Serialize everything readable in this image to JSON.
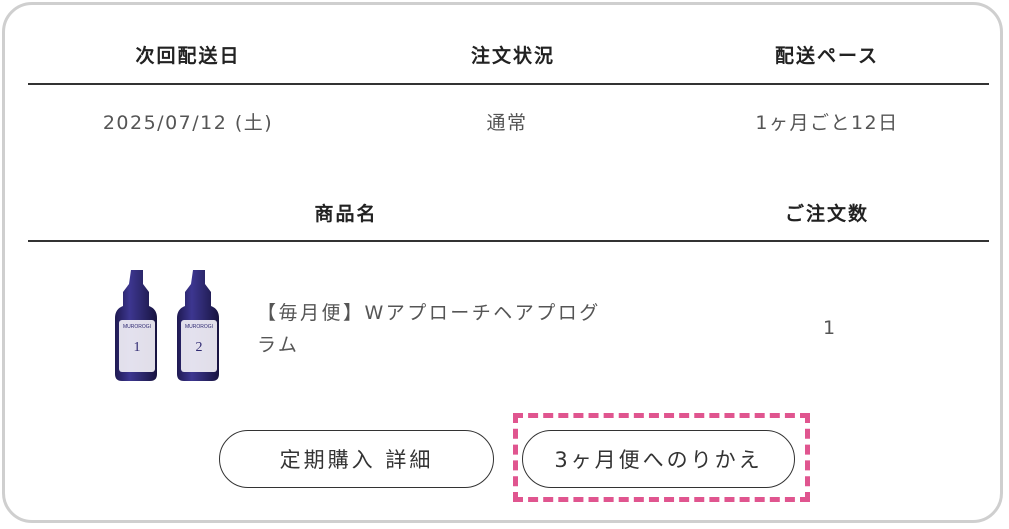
{
  "schedule": {
    "headers": [
      "次回配送日",
      "注文状況",
      "配送ペース"
    ],
    "values": [
      "2025/07/12 (土)",
      "通常",
      "1ヶ月ごと12日"
    ]
  },
  "product_table": {
    "headers": [
      "商品名",
      "ご注文数"
    ],
    "rows": [
      {
        "name_line1": "【毎月便】Wアプローチヘアプログ",
        "name_line2": "ラム",
        "quantity": "1",
        "bottles": [
          {
            "number": "1",
            "brand": "MUROROGI"
          },
          {
            "number": "2",
            "brand": "MUROROGI"
          }
        ]
      }
    ]
  },
  "actions": {
    "detail_label": "定期購入 詳細",
    "switch_label": "3ヶ月便へのりかえ"
  },
  "colors": {
    "highlight": "#e0558f",
    "bottle": "#2f2a72",
    "border": "#cfcfcf"
  }
}
